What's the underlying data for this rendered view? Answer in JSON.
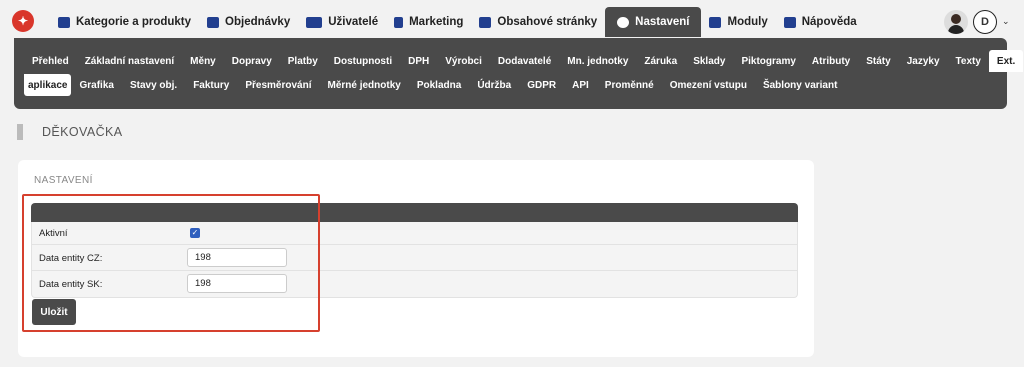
{
  "topnav": {
    "logo": "logo",
    "items": [
      {
        "label": "Kategorie a produkty",
        "icon": "cart-icon",
        "color": "#223f8f"
      },
      {
        "label": "Objednávky",
        "icon": "list-icon",
        "color": "#223f8f"
      },
      {
        "label": "Uživatelé",
        "icon": "users-icon",
        "color": "#223f8f"
      },
      {
        "label": "Marketing",
        "icon": "chart-icon",
        "color": "#223f8f"
      },
      {
        "label": "Obsahové stránky",
        "icon": "edit-icon",
        "color": "#223f8f"
      },
      {
        "label": "Nastavení",
        "icon": "gear-icon",
        "color": "#ffffff"
      },
      {
        "label": "Moduly",
        "icon": "puzzle-icon",
        "color": "#223f8f"
      },
      {
        "label": "Nápověda",
        "icon": "help-icon",
        "color": "#223f8f"
      }
    ],
    "active": "Nastavení",
    "user_initial": "D",
    "user_caret": "⌄"
  },
  "subnav": {
    "row1": [
      "Přehled",
      "Základní nastavení",
      "Měny",
      "Dopravy",
      "Platby",
      "Dostupnosti",
      "DPH",
      "Výrobci",
      "Dodavatelé",
      "Mn. jednotky",
      "Záruka",
      "Sklady",
      "Piktogramy",
      "Atributy",
      "Státy",
      "Jazyky",
      "Texty",
      "Ext."
    ],
    "row2": [
      "aplikace",
      "Grafika",
      "Stavy obj.",
      "Faktury",
      "Přesměrování",
      "Měrné jednotky",
      "Pokladna",
      "Údržba",
      "GDPR",
      "API",
      "Proměnné",
      "Omezení vstupu",
      "Šablony variant"
    ],
    "active": "Ext. aplikace"
  },
  "page": {
    "title": "DĚKOVAČKA"
  },
  "settings": {
    "section_title": "NASTAVENÍ",
    "active_label": "Aktivní",
    "active_checked": true,
    "cz_label": "Data entity CZ:",
    "cz_value": "198",
    "sk_label": "Data entity SK:",
    "sk_value": "198",
    "save_label": "Uložit",
    "highlight_color": "#d6402e"
  }
}
